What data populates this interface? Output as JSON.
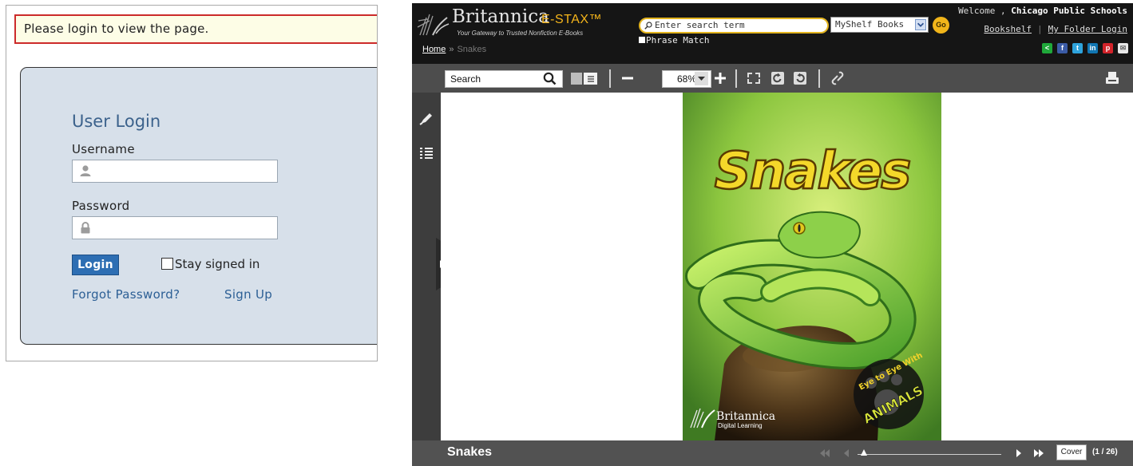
{
  "login": {
    "message": "Please login to view the page.",
    "title": "User Login",
    "username_label": "Username",
    "password_label": "Password",
    "login_button": "Login",
    "stay_signed_in": "Stay signed in",
    "forgot_password": "Forgot Password?",
    "sign_up": "Sign Up",
    "icons": [
      "user-icon",
      "lock-icon"
    ]
  },
  "viewer": {
    "brand": {
      "name": "Britannica",
      "product": "E-STAX™",
      "tagline": "Your Gateway to Trusted Nonfiction E-Books"
    },
    "breadcrumb": {
      "home": "Home",
      "separator": "»",
      "current": "Snakes"
    },
    "search": {
      "placeholder": "Enter search term",
      "scope": "MyShelf Books",
      "go": "Go",
      "phrase_match": "Phrase Match"
    },
    "welcome": {
      "prefix": "Welcome , ",
      "user": "Chicago Public Schools"
    },
    "account_links": {
      "bookshelf": "Bookshelf",
      "folder": "My Folder Login"
    },
    "share_icons": [
      "share-icon",
      "facebook-icon",
      "twitter-icon",
      "linkedin-icon",
      "pinterest-icon",
      "email-icon"
    ],
    "toolbar": {
      "search_value": "Search",
      "zoom": "68%",
      "icons": [
        "search-icon",
        "single-page-icon",
        "two-page-icon",
        "zoom-out-icon",
        "zoom-in-icon",
        "fullscreen-icon",
        "rotate-icon",
        "rotate-back-icon",
        "link-icon",
        "print-icon"
      ]
    },
    "sidebar_icons": [
      "highlight-icon",
      "contents-icon"
    ],
    "book": {
      "title": "Snakes",
      "cover_title": "Snakes",
      "series_badge_top": "Eye to Eye With",
      "series_badge_bottom": "ANIMALS",
      "publisher": "Britannica",
      "publisher_sub": "Digital Learning"
    },
    "pager": {
      "cover_label": "Cover",
      "count": "(1 / 26)",
      "position": 0
    },
    "colors": {
      "accent": "#f1b51a",
      "header": "#151515",
      "toolbar": "#4d4d4d",
      "login_blue": "#2d6eb3"
    }
  }
}
